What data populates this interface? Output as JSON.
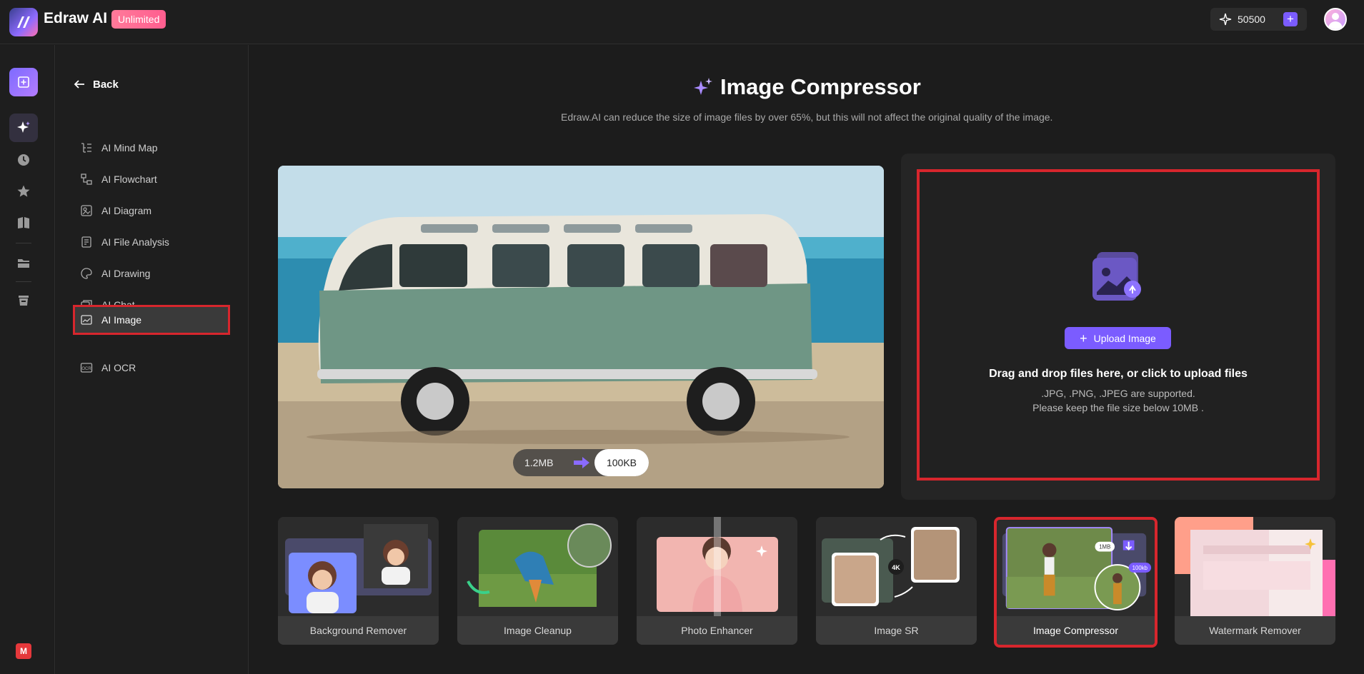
{
  "app": {
    "name": "Edraw AI",
    "plan_badge": "Unlimited",
    "credits": "50500"
  },
  "rail": {
    "monogram": "M"
  },
  "sidebar": {
    "back_label": "Back",
    "items": [
      {
        "label": "AI Mind Map"
      },
      {
        "label": "AI Flowchart"
      },
      {
        "label": "AI Diagram"
      },
      {
        "label": "AI File Analysis"
      },
      {
        "label": "AI Drawing"
      },
      {
        "label": "AI Chat"
      },
      {
        "label": "AI Image"
      },
      {
        "label": "AI OCR"
      }
    ]
  },
  "page": {
    "title": "Image Compressor",
    "subtitle": "Edraw.AI can reduce the size of image files by over 65%, but this will not affect the original quality of the image."
  },
  "hero": {
    "size_from": "1.2MB",
    "size_to": "100KB"
  },
  "upload": {
    "button_label": "Upload Image",
    "drop_title": "Drag and drop files here, or click to upload files",
    "formats": ".JPG, .PNG, .JPEG are supported.",
    "limit": "Please keep the file size below 10MB ."
  },
  "tools": [
    {
      "label": "Background Remover"
    },
    {
      "label": "Image Cleanup"
    },
    {
      "label": "Photo Enhancer"
    },
    {
      "label": "Image SR"
    },
    {
      "label": "Image Compressor",
      "badge_top": "1MB",
      "badge_bottom": "100kb"
    },
    {
      "label": "Watermark Remover"
    }
  ],
  "tool_image_sr_badge": "4K",
  "colors": {
    "accent": "#7b5cff",
    "highlight": "#d7262d",
    "bg": "#1c1c1c"
  }
}
